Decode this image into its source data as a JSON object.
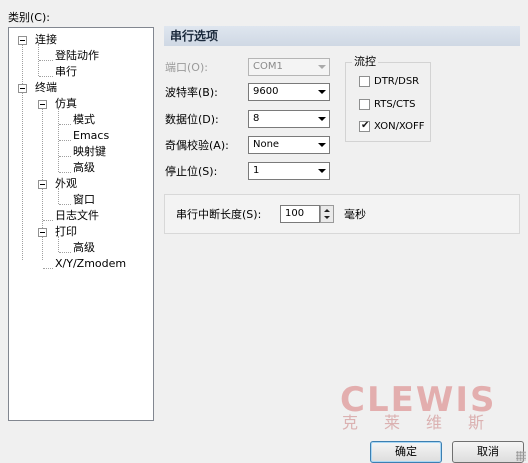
{
  "category_label": "类别(C):",
  "tree": {
    "items": [
      {
        "label": "连接"
      },
      {
        "label": "登陆动作"
      },
      {
        "label": "串行"
      },
      {
        "label": "终端"
      },
      {
        "label": "仿真"
      },
      {
        "label": "模式"
      },
      {
        "label": "Emacs"
      },
      {
        "label": "映射键"
      },
      {
        "label": "高级"
      },
      {
        "label": "外观"
      },
      {
        "label": "窗口"
      },
      {
        "label": "日志文件"
      },
      {
        "label": "打印"
      },
      {
        "label": "高级"
      },
      {
        "label": "X/Y/Zmodem"
      }
    ]
  },
  "section_title": "串行选项",
  "fields": {
    "port": {
      "label": "端口(O):",
      "value": "COM1"
    },
    "baud": {
      "label": "波特率(B):",
      "value": "9600"
    },
    "data_bits": {
      "label": "数据位(D):",
      "value": "8"
    },
    "parity": {
      "label": "奇偶校验(A):",
      "value": "None"
    },
    "stop_bits": {
      "label": "停止位(S):",
      "value": "1"
    }
  },
  "flow_control": {
    "title": "流控",
    "options": [
      {
        "label": "DTR/DSR",
        "checked": false
      },
      {
        "label": "RTS/CTS",
        "checked": false
      },
      {
        "label": "XON/XOFF",
        "checked": true
      }
    ]
  },
  "serial_break": {
    "label": "串行中断长度(S):",
    "value": "100",
    "unit": "毫秒"
  },
  "watermark": {
    "logo": "CLEWIS",
    "subtitle": "克莱维斯"
  },
  "buttons": {
    "ok": "确定",
    "cancel": "取消"
  }
}
